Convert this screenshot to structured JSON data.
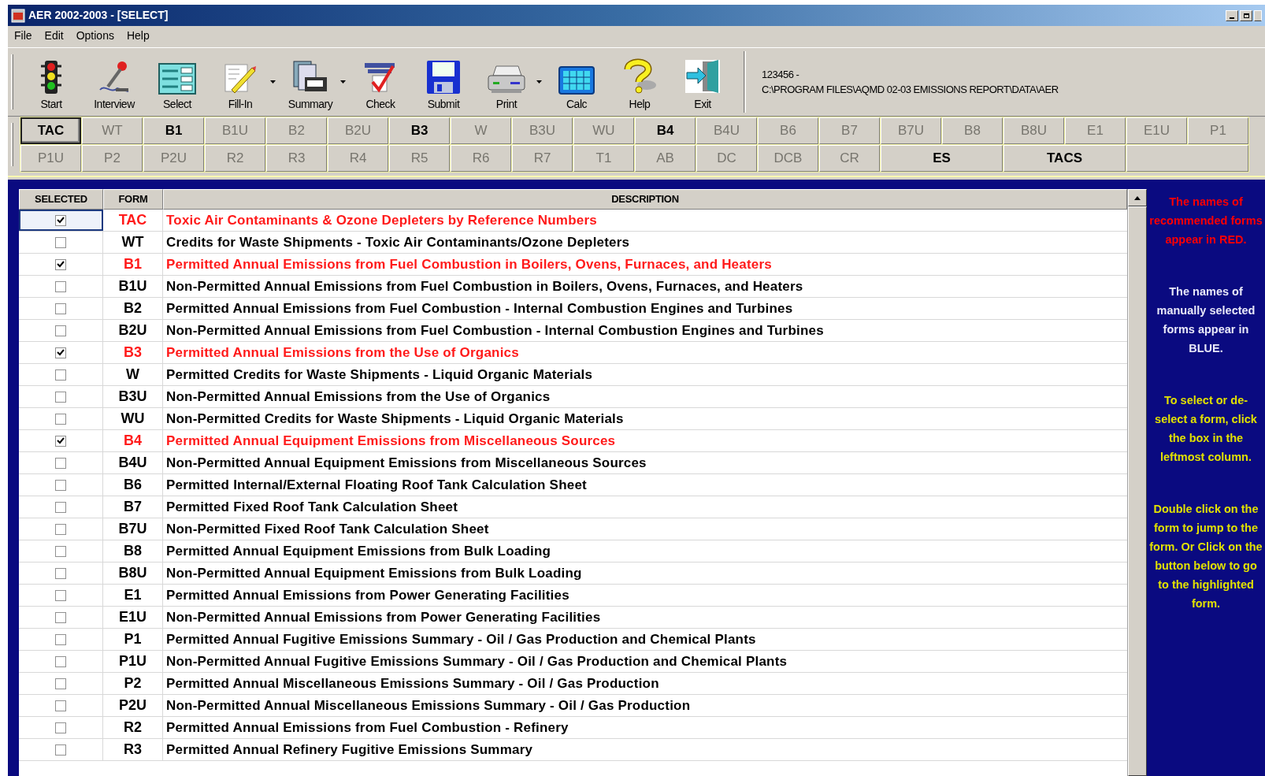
{
  "window": {
    "title": "AER 2002-2003 - [SELECT]"
  },
  "menu": [
    "File",
    "Edit",
    "Options",
    "Help"
  ],
  "toolbar": [
    {
      "label": "Start",
      "dropdown": false
    },
    {
      "label": "Interview",
      "dropdown": false
    },
    {
      "label": "Select",
      "dropdown": false
    },
    {
      "label": "Fill-In",
      "dropdown": true
    },
    {
      "label": "Summary",
      "dropdown": true
    },
    {
      "label": "Check",
      "dropdown": false
    },
    {
      "label": "Submit",
      "dropdown": false
    },
    {
      "label": "Print",
      "dropdown": true
    },
    {
      "label": "Calc",
      "dropdown": false
    },
    {
      "label": "Help",
      "dropdown": false
    },
    {
      "label": "Exit",
      "dropdown": false
    }
  ],
  "info": {
    "id": "123456 -",
    "path": "C:\\PROGRAM FILES\\AQMD 02-03 EMISSIONS REPORT\\DATA\\AER"
  },
  "form_buttons": [
    [
      {
        "label": "TAC",
        "enabled": true,
        "selected": true
      },
      {
        "label": "WT",
        "enabled": false,
        "selected": false
      },
      {
        "label": "B1",
        "enabled": true,
        "selected": false
      },
      {
        "label": "B1U",
        "enabled": false,
        "selected": false
      },
      {
        "label": "B2",
        "enabled": false,
        "selected": false
      },
      {
        "label": "B2U",
        "enabled": false,
        "selected": false
      },
      {
        "label": "B3",
        "enabled": true,
        "selected": false
      },
      {
        "label": "W",
        "enabled": false,
        "selected": false
      },
      {
        "label": "B3U",
        "enabled": false,
        "selected": false
      },
      {
        "label": "WU",
        "enabled": false,
        "selected": false
      },
      {
        "label": "B4",
        "enabled": true,
        "selected": false
      },
      {
        "label": "B4U",
        "enabled": false,
        "selected": false
      },
      {
        "label": "B6",
        "enabled": false,
        "selected": false
      },
      {
        "label": "B7",
        "enabled": false,
        "selected": false
      },
      {
        "label": "B7U",
        "enabled": false,
        "selected": false
      },
      {
        "label": "B8",
        "enabled": false,
        "selected": false
      },
      {
        "label": "B8U",
        "enabled": false,
        "selected": false
      },
      {
        "label": "E1",
        "enabled": false,
        "selected": false
      },
      {
        "label": "E1U",
        "enabled": false,
        "selected": false
      },
      {
        "label": "P1",
        "enabled": false,
        "selected": false
      }
    ],
    [
      {
        "label": "P1U",
        "enabled": false,
        "selected": false
      },
      {
        "label": "P2",
        "enabled": false,
        "selected": false
      },
      {
        "label": "P2U",
        "enabled": false,
        "selected": false
      },
      {
        "label": "R2",
        "enabled": false,
        "selected": false
      },
      {
        "label": "R3",
        "enabled": false,
        "selected": false
      },
      {
        "label": "R4",
        "enabled": false,
        "selected": false
      },
      {
        "label": "R5",
        "enabled": false,
        "selected": false
      },
      {
        "label": "R6",
        "enabled": false,
        "selected": false
      },
      {
        "label": "R7",
        "enabled": false,
        "selected": false
      },
      {
        "label": "T1",
        "enabled": false,
        "selected": false
      },
      {
        "label": "AB",
        "enabled": false,
        "selected": false
      },
      {
        "label": "DC",
        "enabled": false,
        "selected": false
      },
      {
        "label": "DCB",
        "enabled": false,
        "selected": false
      },
      {
        "label": "CR",
        "enabled": false,
        "selected": false
      },
      {
        "label": "ES",
        "enabled": true,
        "selected": false
      },
      {
        "label": "TACS",
        "enabled": true,
        "selected": false
      }
    ]
  ],
  "table": {
    "columns": [
      "SELECTED",
      "FORM",
      "DESCRIPTION"
    ],
    "rows": [
      {
        "checked": true,
        "recommended": true,
        "selected": true,
        "form": "TAC",
        "description": "Toxic Air Contaminants & Ozone Depleters by Reference Numbers"
      },
      {
        "checked": false,
        "recommended": false,
        "selected": false,
        "form": "WT",
        "description": "Credits for Waste Shipments - Toxic Air Contaminants/Ozone Depleters"
      },
      {
        "checked": true,
        "recommended": true,
        "selected": false,
        "form": "B1",
        "description": "Permitted Annual Emissions from Fuel Combustion in Boilers, Ovens, Furnaces, and Heaters"
      },
      {
        "checked": false,
        "recommended": false,
        "selected": false,
        "form": "B1U",
        "description": "Non-Permitted Annual Emissions from Fuel Combustion in Boilers, Ovens, Furnaces, and Heaters"
      },
      {
        "checked": false,
        "recommended": false,
        "selected": false,
        "form": "B2",
        "description": "Permitted Annual Emissions from Fuel Combustion - Internal Combustion Engines and Turbines"
      },
      {
        "checked": false,
        "recommended": false,
        "selected": false,
        "form": "B2U",
        "description": "Non-Permitted Annual Emissions from Fuel Combustion - Internal Combustion Engines and Turbines"
      },
      {
        "checked": true,
        "recommended": true,
        "selected": false,
        "form": "B3",
        "description": "Permitted Annual Emissions from the Use of Organics"
      },
      {
        "checked": false,
        "recommended": false,
        "selected": false,
        "form": "W",
        "description": "Permitted Credits for Waste Shipments - Liquid Organic Materials"
      },
      {
        "checked": false,
        "recommended": false,
        "selected": false,
        "form": "B3U",
        "description": "Non-Permitted Annual Emissions from the Use of Organics"
      },
      {
        "checked": false,
        "recommended": false,
        "selected": false,
        "form": "WU",
        "description": "Non-Permitted Credits for Waste Shipments - Liquid Organic Materials"
      },
      {
        "checked": true,
        "recommended": true,
        "selected": false,
        "form": "B4",
        "description": "Permitted Annual Equipment Emissions from Miscellaneous Sources"
      },
      {
        "checked": false,
        "recommended": false,
        "selected": false,
        "form": "B4U",
        "description": "Non-Permitted Annual Equipment Emissions from Miscellaneous Sources"
      },
      {
        "checked": false,
        "recommended": false,
        "selected": false,
        "form": "B6",
        "description": "Permitted Internal/External Floating Roof Tank Calculation Sheet"
      },
      {
        "checked": false,
        "recommended": false,
        "selected": false,
        "form": "B7",
        "description": "Permitted Fixed Roof Tank Calculation Sheet"
      },
      {
        "checked": false,
        "recommended": false,
        "selected": false,
        "form": "B7U",
        "description": "Non-Permitted Fixed Roof Tank Calculation Sheet"
      },
      {
        "checked": false,
        "recommended": false,
        "selected": false,
        "form": "B8",
        "description": "Permitted Annual Equipment Emissions from Bulk Loading"
      },
      {
        "checked": false,
        "recommended": false,
        "selected": false,
        "form": "B8U",
        "description": "Non-Permitted Annual Equipment Emissions from Bulk Loading"
      },
      {
        "checked": false,
        "recommended": false,
        "selected": false,
        "form": "E1",
        "description": "Permitted Annual Emissions from Power Generating Facilities"
      },
      {
        "checked": false,
        "recommended": false,
        "selected": false,
        "form": "E1U",
        "description": "Non-Permitted Annual Emissions from Power Generating Facilities"
      },
      {
        "checked": false,
        "recommended": false,
        "selected": false,
        "form": "P1",
        "description": "Permitted Annual Fugitive Emissions Summary - Oil / Gas Production and Chemical Plants"
      },
      {
        "checked": false,
        "recommended": false,
        "selected": false,
        "form": "P1U",
        "description": "Non-Permitted Annual Fugitive Emissions Summary - Oil / Gas Production and Chemical Plants"
      },
      {
        "checked": false,
        "recommended": false,
        "selected": false,
        "form": "P2",
        "description": "Permitted Annual Miscellaneous Emissions Summary - Oil / Gas Production"
      },
      {
        "checked": false,
        "recommended": false,
        "selected": false,
        "form": "P2U",
        "description": "Non-Permitted Annual Miscellaneous Emissions Summary - Oil / Gas Production"
      },
      {
        "checked": false,
        "recommended": false,
        "selected": false,
        "form": "R2",
        "description": "Permitted Annual Emissions from Fuel Combustion - Refinery"
      },
      {
        "checked": false,
        "recommended": false,
        "selected": false,
        "form": "R3",
        "description": "Permitted Annual Refinery Fugitive Emissions Summary"
      }
    ]
  },
  "help_panel": [
    {
      "text": "The names of recommended forms appear in RED.",
      "color": "#ff0000"
    },
    {
      "text": "The names of manually selected forms appear in BLUE.",
      "color": "#e8e8f8"
    },
    {
      "text": "To select or de-select a form, click the box in the leftmost column.",
      "color": "#e0e000"
    },
    {
      "text": "Double click on the form to jump to the form. Or Click on the button below to go to the highlighted form.",
      "color": "#e0e000"
    }
  ]
}
